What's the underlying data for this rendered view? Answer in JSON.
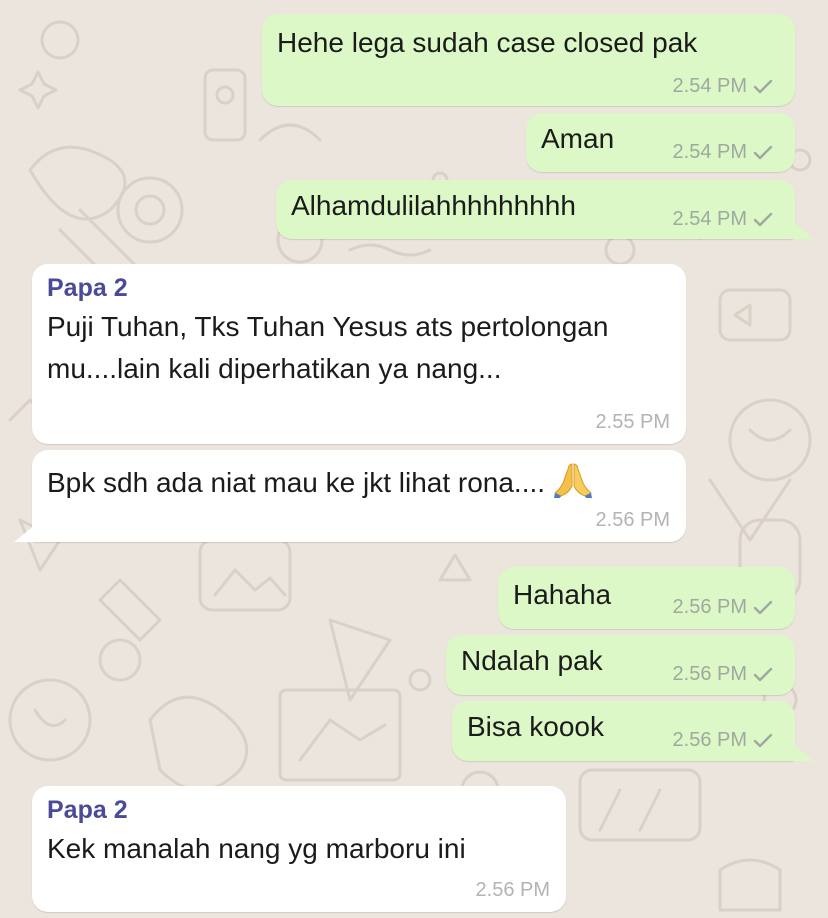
{
  "colors": {
    "background": "#ece5dd",
    "outgoing_bubble": "#dcf8c6",
    "incoming_bubble": "#ffffff",
    "sender_name": "#4b4a98",
    "timestamp": "#a0a8a0"
  },
  "messages": [
    {
      "direction": "out",
      "text": "Hehe lega sudah case closed pak",
      "time": "2.54 PM",
      "status_icon": "single-check-icon"
    },
    {
      "direction": "out",
      "text": "Aman",
      "time": "2.54 PM",
      "status_icon": "single-check-icon"
    },
    {
      "direction": "out",
      "text": "Alhamdulilahhhhhhhhh",
      "time": "2.54 PM",
      "status_icon": "single-check-icon"
    },
    {
      "direction": "in",
      "sender": "Papa 2",
      "text": "Puji Tuhan, Tks Tuhan Yesus ats pertolongan mu....lain kali  diperhatikan ya nang...",
      "time": "2.55 PM"
    },
    {
      "direction": "in",
      "text": "Bpk sdh ada niat mau ke jkt lihat rona....",
      "emoji": "folded-hands-emoji",
      "time": "2.56 PM"
    },
    {
      "direction": "out",
      "text": "Hahaha",
      "time": "2.56 PM",
      "status_icon": "single-check-icon"
    },
    {
      "direction": "out",
      "text": "Ndalah pak",
      "time": "2.56 PM",
      "status_icon": "single-check-icon"
    },
    {
      "direction": "out",
      "text": "Bisa koook",
      "time": "2.56 PM",
      "status_icon": "single-check-icon"
    },
    {
      "direction": "in",
      "sender": "Papa 2",
      "text": "Kek manalah nang yg marboru ini",
      "time": "2.56 PM"
    }
  ]
}
